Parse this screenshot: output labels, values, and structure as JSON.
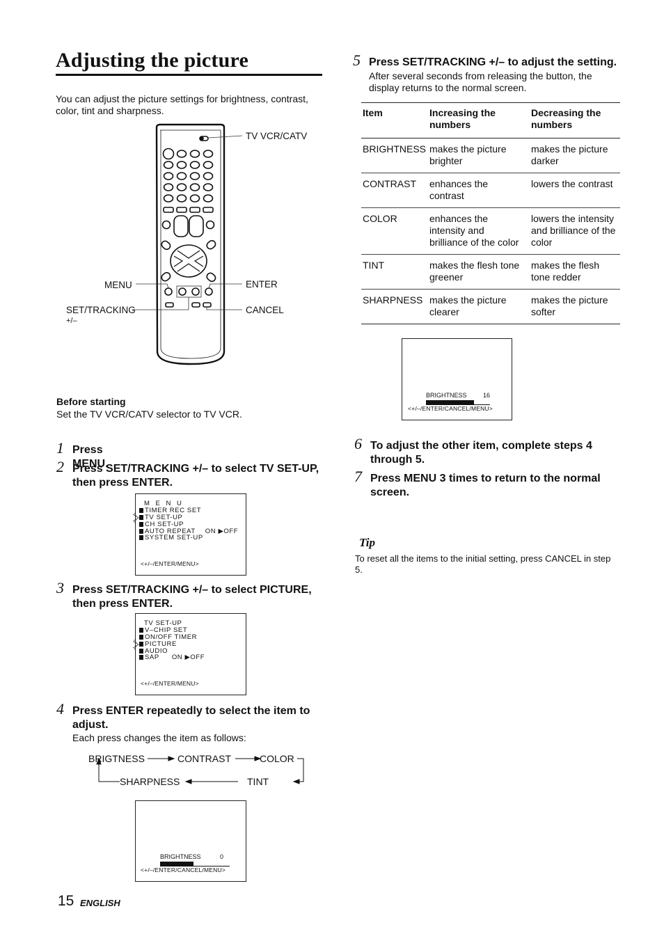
{
  "page": {
    "title": "Adjusting the picture",
    "intro": "You can adjust the picture settings for brightness, contrast, color, tint and sharpness.",
    "page_number": "15",
    "language": "ENGLISH"
  },
  "remote": {
    "callouts": {
      "tv_vcr_catv": "TV VCR/CATV",
      "menu": "MENU",
      "enter": "ENTER",
      "set_tracking": "SET/TRACKING",
      "set_tracking_sub": "+/–",
      "cancel": "CANCEL"
    }
  },
  "before_starting": {
    "heading": "Before starting",
    "text": "Set the TV VCR/CATV selector to TV VCR."
  },
  "steps": [
    {
      "num": "1",
      "text": "Press MENU."
    },
    {
      "num": "2",
      "text_line1": "Press SET/TRACKING +/– to select TV SET-UP,",
      "text_line2": "then press ENTER."
    },
    {
      "num": "3",
      "text_line1": "Press SET/TRACKING +/– to select PICTURE,",
      "text_line2": "then press ENTER."
    },
    {
      "num": "4",
      "text_line1": "Press ENTER repeatedly to select the item to",
      "text_line2": "adjust.",
      "sub": "Each press changes the item as follows:"
    },
    {
      "num": "5",
      "text": "Press SET/TRACKING +/– to adjust the setting.",
      "sub_line1": "After several seconds from releasing the button, the",
      "sub_line2": "display returns to the normal screen."
    },
    {
      "num": "6",
      "text_line1": "To adjust the other item, complete steps 4",
      "text_line2": "through 5."
    },
    {
      "num": "7",
      "text_line1": "Press MENU 3 times to return to the normal",
      "text_line2": "screen."
    }
  ],
  "menu_screen": {
    "title": "M E N U",
    "items": [
      {
        "label": "TIMER REC SET",
        "value": ""
      },
      {
        "label": "TV SET-UP",
        "value": "",
        "selected": true
      },
      {
        "label": "CH SET-UP",
        "value": ""
      },
      {
        "label": "AUTO REPEAT",
        "value": "ON ▶OFF"
      },
      {
        "label": "SYSTEM SET-UP",
        "value": ""
      }
    ],
    "footer": "<+/–/ENTER/MENU>"
  },
  "tv_setup_screen": {
    "title": "TV SET-UP",
    "items": [
      {
        "label": "V–CHIP SET",
        "value": ""
      },
      {
        "label": "ON/OFF TIMER",
        "value": ""
      },
      {
        "label": "PICTURE",
        "value": "",
        "selected": true
      },
      {
        "label": "AUDIO",
        "value": ""
      },
      {
        "label": "SAP",
        "value": "ON ▶OFF"
      }
    ],
    "footer": "<+/–/ENTER/MENU>"
  },
  "cycle": {
    "items": [
      "BRIGTNESS",
      "CONTRAST",
      "COLOR",
      "TINT",
      "SHARPNESS"
    ]
  },
  "brightness_screen_step4": {
    "label": "BRIGHTNESS",
    "value": "0",
    "bar_fill_fraction": 0.48,
    "footer": "<+/–/ENTER/CANCEL/MENU>"
  },
  "brightness_screen_step5": {
    "label": "BRIGHTNESS",
    "value": "16",
    "bar_fill_fraction": 0.75,
    "footer": "<+/–/ENTER/CANCEL/MENU>"
  },
  "table": {
    "headers": [
      "Item",
      "Increasing the numbers",
      "Decreasing the numbers"
    ],
    "header_lines": [
      [
        "Item",
        ""
      ],
      [
        "Increasing the",
        "numbers"
      ],
      [
        "Decreasing the",
        "numbers"
      ]
    ],
    "rows": [
      {
        "item": "BRIGHTNESS",
        "increase": [
          "makes the picture",
          "brighter"
        ],
        "decrease": [
          "makes the picture",
          "darker"
        ]
      },
      {
        "item": "CONTRAST",
        "increase": [
          "enhances the",
          "contrast"
        ],
        "decrease": [
          "lowers the contrast"
        ]
      },
      {
        "item": "COLOR",
        "increase": [
          "enhances the",
          "intensity and",
          "brilliance of the color"
        ],
        "decrease": [
          "lowers the intensity",
          "and brilliance of the",
          "color"
        ]
      },
      {
        "item": "TINT",
        "increase": [
          "makes the flesh tone",
          "greener"
        ],
        "decrease": [
          "makes the flesh",
          "tone redder"
        ]
      },
      {
        "item": "SHARPNESS",
        "increase": [
          "makes the picture",
          "clearer"
        ],
        "decrease": [
          "makes the picture",
          "softer"
        ]
      }
    ]
  },
  "tip": {
    "heading": "Tip",
    "text": "To reset all the items to the initial setting, press CANCEL in step 5."
  }
}
